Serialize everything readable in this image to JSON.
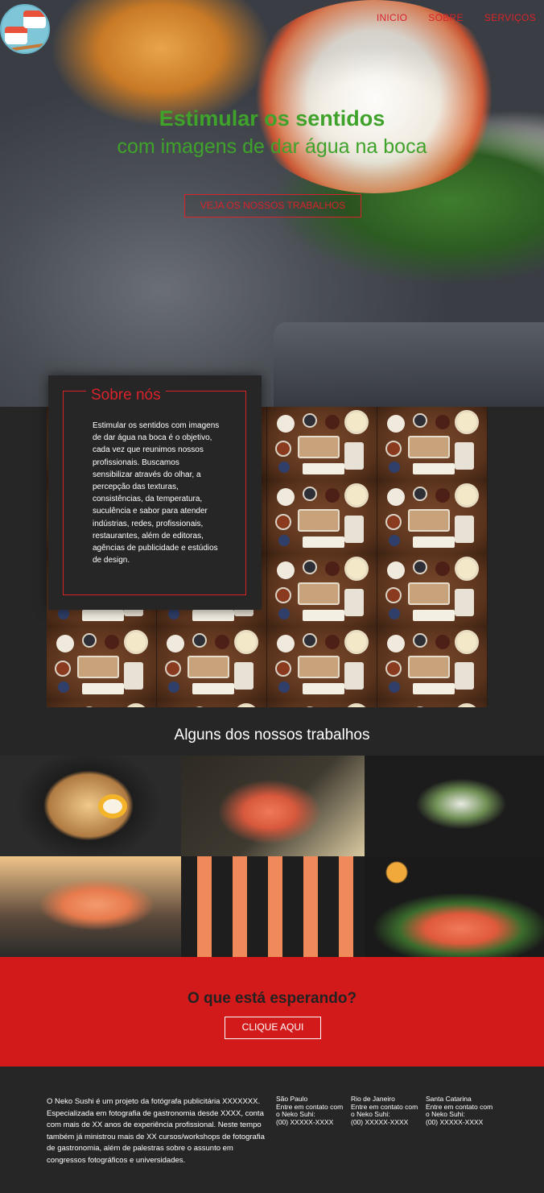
{
  "nav": {
    "items": [
      {
        "label": "INICIO"
      },
      {
        "label": "SOBRE"
      },
      {
        "label": "SERVIÇOS"
      }
    ]
  },
  "hero": {
    "title": "Estimular os sentidos",
    "subtitle": "com imagens de dar água na boca",
    "button_label": "VEJA OS NOSSOS TRABALHOS"
  },
  "about": {
    "title": "Sobre nós",
    "text": "Estimular os sentidos com imagens de dar água na boca é o objetivo, cada vez que reunimos nossos profissionais. Buscamos sensibilizar através do olhar, a percepção das texturas, consistências, da temperatura, suculência e sabor para atender indústrias, redes, profissionais, restaurantes, além de editoras, agências de publicidade e estúdios de design."
  },
  "works": {
    "title": "Alguns dos nossos trabalhos"
  },
  "cta": {
    "title": "O que está esperando?",
    "button_label": "CLIQUE AQUI"
  },
  "footer": {
    "about": "O Neko Sushi é um projeto da fotógrafa publicitária XXXXXXX. Especializada em fotografia de gastronomia desde XXXX, conta com mais de XX anos de experiência profissional. Neste tempo também já ministrou mais de XX cursos/workshops de fotografia de gastronomia, além de palestras sobre o assunto em congressos fotográficos e universidades.",
    "cities": [
      {
        "name": "São Paulo",
        "contact": "Entre em contato com o Neko Suhi:",
        "phone": "(00) XXXXX-XXXX"
      },
      {
        "name": "Rio de Janeiro",
        "contact": "Entre em contato com o Neko Suhi:",
        "phone": "(00) XXXXX-XXXX"
      },
      {
        "name": "Santa Catarina",
        "contact": "Entre em contato com o Neko Suhi:",
        "phone": "(00) XXXXX-XXXX"
      }
    ]
  },
  "colors": {
    "accent_red": "#d8232a",
    "accent_green": "#3fa32b",
    "cta_background": "#d21a1a",
    "page_background": "#262626"
  }
}
